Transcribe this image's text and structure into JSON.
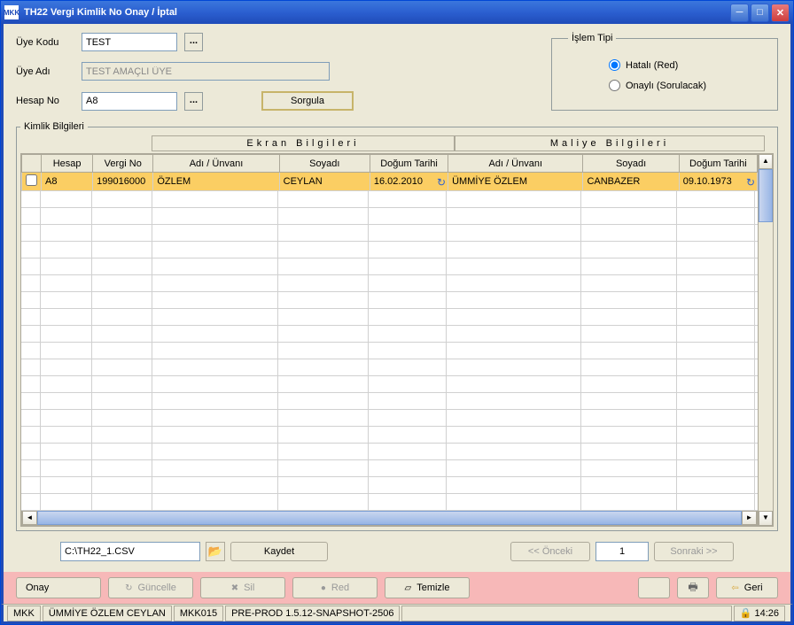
{
  "titlebar": {
    "icon": "MKK",
    "text": "TH22 Vergi Kimlik No Onay / İptal"
  },
  "form": {
    "uye_kodu_label": "Üye Kodu",
    "uye_kodu_value": "TEST",
    "uye_adi_label": "Üye Adı",
    "uye_adi_value": "TEST AMAÇLI ÜYE",
    "hesap_no_label": "Hesap No",
    "hesap_no_value": "A8",
    "sorgula": "Sorgula",
    "lookup": "..."
  },
  "islem_tipi": {
    "legend": "İşlem Tipi",
    "hatali": "Hatalı (Red)",
    "onayli": "Onaylı (Sorulacak)"
  },
  "kimlik": {
    "legend": "Kimlik Bilgileri",
    "group_ekran": "Ekran Bilgileri",
    "group_maliye": "Maliye Bilgileri",
    "cols": {
      "empty": "",
      "hesap": "Hesap",
      "vergi_no": "Vergi No",
      "adi_unvani": "Adı / Ünvanı",
      "soyadi": "Soyadı",
      "dogum_tarihi": "Doğum Tarihi",
      "m_adi_unvani": "Adı / Ünvanı",
      "m_soyadi": "Soyadı",
      "m_dogum_tarihi": "Doğum Tarihi"
    },
    "row": {
      "hesap": "A8",
      "vergi_no": "199016000",
      "adi": "ÖZLEM",
      "soyadi": "CEYLAN",
      "dogum": "16.02.2010",
      "m_adi": "ÜMMİYE ÖZLEM",
      "m_soyadi": "CANBAZER",
      "m_dogum": "09.10.1973"
    }
  },
  "file": {
    "path": "C:\\TH22_1.CSV",
    "kaydet": "Kaydet",
    "onceki": "<< Önceki",
    "page": "1",
    "sonraki": "Sonraki >>"
  },
  "actions": {
    "onay": "Onay",
    "guncelle": "Güncelle",
    "sil": "Sil",
    "red": "Red",
    "temizle": "Temizle",
    "geri": "Geri"
  },
  "status": {
    "s1": "MKK",
    "s2": "ÜMMİYE ÖZLEM CEYLAN",
    "s3": "MKK015",
    "s4": "PRE-PROD 1.5.12-SNAPSHOT-2506",
    "time": "14:26"
  }
}
